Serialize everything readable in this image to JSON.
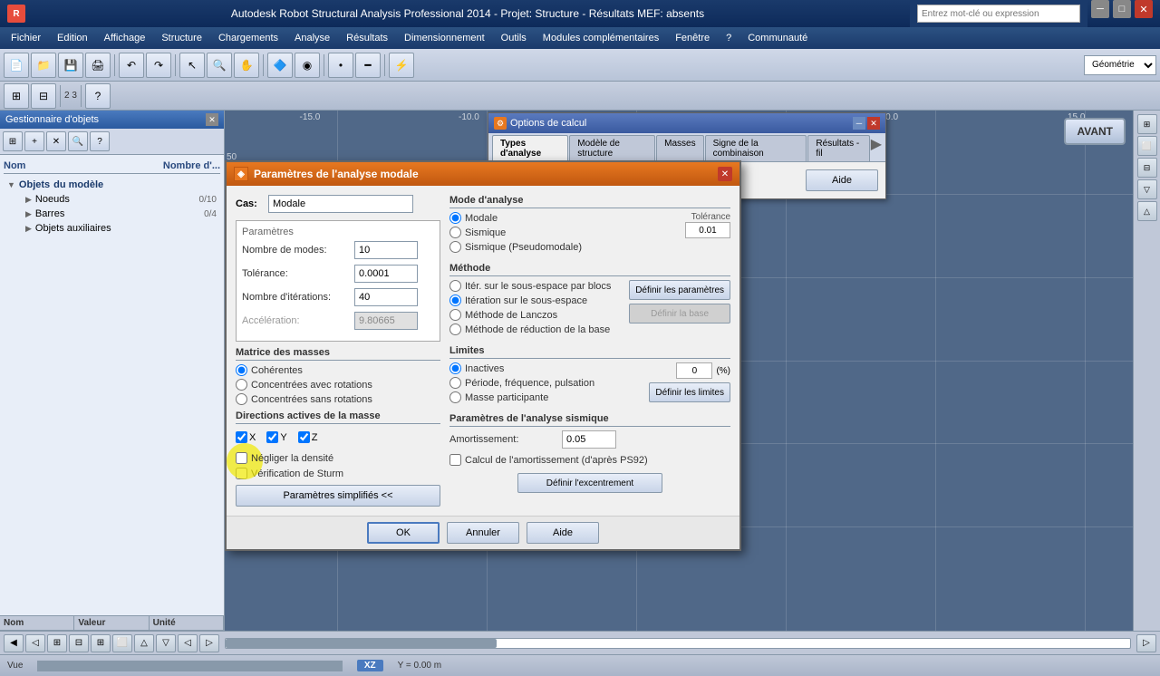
{
  "window": {
    "title": "Autodesk Robot Structural Analysis Professional 2014 - Projet: Structure - Résultats MEF: absents",
    "search_placeholder": "Entrez mot-clé ou expression"
  },
  "menu": {
    "items": [
      "Fichier",
      "Edition",
      "Affichage",
      "Structure",
      "Chargements",
      "Analyse",
      "Résultats",
      "Dimensionnement",
      "Outils",
      "Modules complémentaires",
      "Fenêtre",
      "?",
      "Communauté"
    ]
  },
  "left_panel": {
    "title": "Gestionnaire d'objets",
    "tree": {
      "header_name": "Nom",
      "header_value": "Nombre d'...",
      "root": "Objets du modèle",
      "items": [
        {
          "label": "Noeuds",
          "count": "0/10"
        },
        {
          "label": "Barres",
          "count": "0/4"
        },
        {
          "label": "Objets auxiliaires",
          "count": ""
        }
      ]
    },
    "table_columns": [
      "Nom",
      "Valeur",
      "Unité"
    ]
  },
  "toolbar_combo": {
    "geometry_label": "Géométrie"
  },
  "options_dialog": {
    "title": "Options de calcul",
    "tabs": [
      "Types d'analyse",
      "Modèle de structure",
      "Masses",
      "Signe de la combinaison",
      "Résultats - fil"
    ],
    "active_tab": "Types d'analyse"
  },
  "modal_dialog": {
    "title": "Paramètres de l'analyse modale",
    "cas_label": "Cas:",
    "cas_value": "Modale",
    "params_section": "Paramètres",
    "fields": {
      "nombre_modes_label": "Nombre de modes:",
      "nombre_modes_value": "10",
      "tolerance_label": "Tolérance:",
      "tolerance_value": "0.0001",
      "iterations_label": "Nombre d'itérations:",
      "iterations_value": "40",
      "acceleration_label": "Accélération:",
      "acceleration_value": "9.80665"
    },
    "matrice_section": "Matrice des masses",
    "matrice_options": [
      "Cohérentes",
      "Concentrées avec rotations",
      "Concentrées sans rotations"
    ],
    "matrice_selected": "Cohérentes",
    "directions_section": "Directions actives de la masse",
    "directions": [
      "X",
      "Y",
      "Z"
    ],
    "directions_checked": [
      true,
      true,
      true
    ],
    "check_negliger": "Négliger la densité",
    "check_negliger_checked": false,
    "check_sturm": "Vérification de Sturm",
    "check_sturm_checked": false,
    "params_simplifies": "Paramètres simplifiés <<",
    "mode_section": "Mode d'analyse",
    "mode_options": [
      "Modale",
      "Sismique",
      "Sismique (Pseudomodale)"
    ],
    "mode_selected": "Modale",
    "tolerance_section": "Tolérance",
    "tolerance_val": "0.01",
    "methode_section": "Méthode",
    "methode_options": [
      "Itér. sur le sous-espace par blocs",
      "Itération sur le sous-espace",
      "Méthode de Lanczos",
      "Méthode de réduction de la base"
    ],
    "methode_selected": "Itération sur le sous-espace",
    "btn_definir_params": "Définir les paramètres",
    "btn_definir_base": "Définir la base",
    "limites_section": "Limites",
    "limites_options": [
      "Inactives",
      "Période, fréquence, pulsation",
      "Masse participante"
    ],
    "limites_selected": "Inactives",
    "limites_value": "0",
    "limites_pct": "(%)",
    "btn_definir_limites": "Définir les limites",
    "seismique_section": "Paramètres de l'analyse sismique",
    "amortissement_label": "Amortissement:",
    "amortissement_value": "0.05",
    "calcul_amort_label": "Calcul de l'amortissement (d'après PS92)",
    "calcul_amort_checked": false,
    "btn_excentrement": "Définir l'excentrement",
    "buttons": {
      "ok": "OK",
      "annuler": "Annuler",
      "aide": "Aide"
    },
    "aide_btn": "Aide"
  },
  "canvas": {
    "coordinates": "XZ",
    "y_position": "Y = 0.00 m",
    "avant_label": "AVANT"
  },
  "status_bar": {
    "view_label": "Vue"
  },
  "icons": {
    "close": "✕",
    "minimize": "─",
    "maximize": "□",
    "expand": "▶",
    "collapse": "▼",
    "scroll_up": "▲",
    "scroll_down": "▼",
    "scroll_left": "◀",
    "scroll_right": "▶",
    "question": "?",
    "search": "🔍"
  }
}
